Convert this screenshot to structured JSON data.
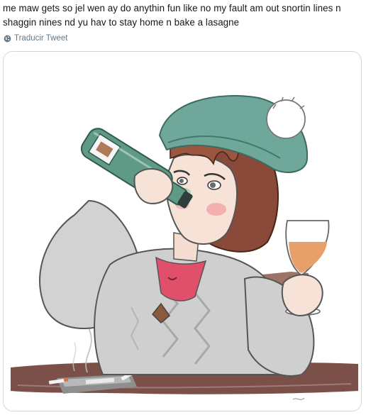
{
  "tweet": {
    "text": "me maw gets so jel wen ay do anythin fun like no my fault am out snortin lines n shaggin nines nd yu hav to stay home n bake a lasagne",
    "translate_icon": "globe-icon",
    "translate_label": "Traducir Tweet"
  },
  "media": {
    "description_icon": "illustration",
    "colors": {
      "hat": "#6fa89a",
      "hair": "#8a4a3a",
      "cardigan": "#cfcfcf",
      "shirt": "#e0506a",
      "bottle": "#5f9a86",
      "wine": "#e8a06a",
      "table": "#7a5048"
    }
  }
}
